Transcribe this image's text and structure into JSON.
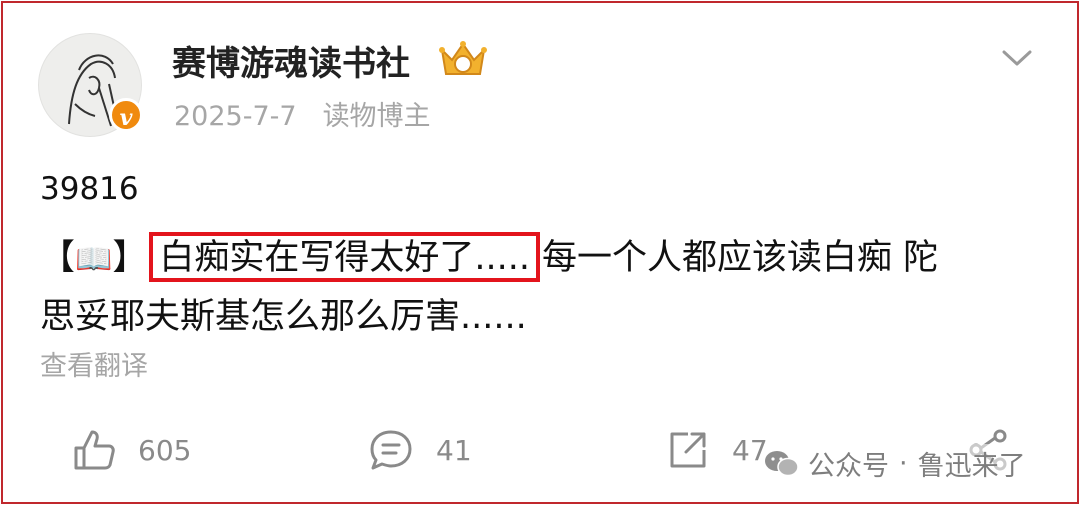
{
  "post": {
    "author": "赛博游魂读书社",
    "date": "2025-7-7",
    "tag": "读物博主",
    "id_number": "39816",
    "line1_open": "【",
    "book_emoji": "📖",
    "line1_close": "】",
    "highlight": "白痴实在写得太好了.....",
    "line1_rest": "每一个人都应该读白痴 陀",
    "line2": "思妥耶夫斯基怎么那么厉害......",
    "translate": "查看翻译"
  },
  "actions": {
    "likes": "605",
    "comments": "41",
    "reposts": "47"
  },
  "watermark": {
    "label": "公众号",
    "separator": "·",
    "account": "鲁迅来了"
  },
  "colors": {
    "frame_border": "#c0282d",
    "highlight_border": "#e3141c",
    "verified_badge": "#f08a0e",
    "meta_gray": "#a6a6a6"
  },
  "icons": [
    "avatar",
    "verified-badge-icon",
    "crown-icon",
    "chevron-down-icon",
    "like-icon",
    "comment-icon",
    "repost-icon",
    "share-icon",
    "wechat-icon"
  ]
}
